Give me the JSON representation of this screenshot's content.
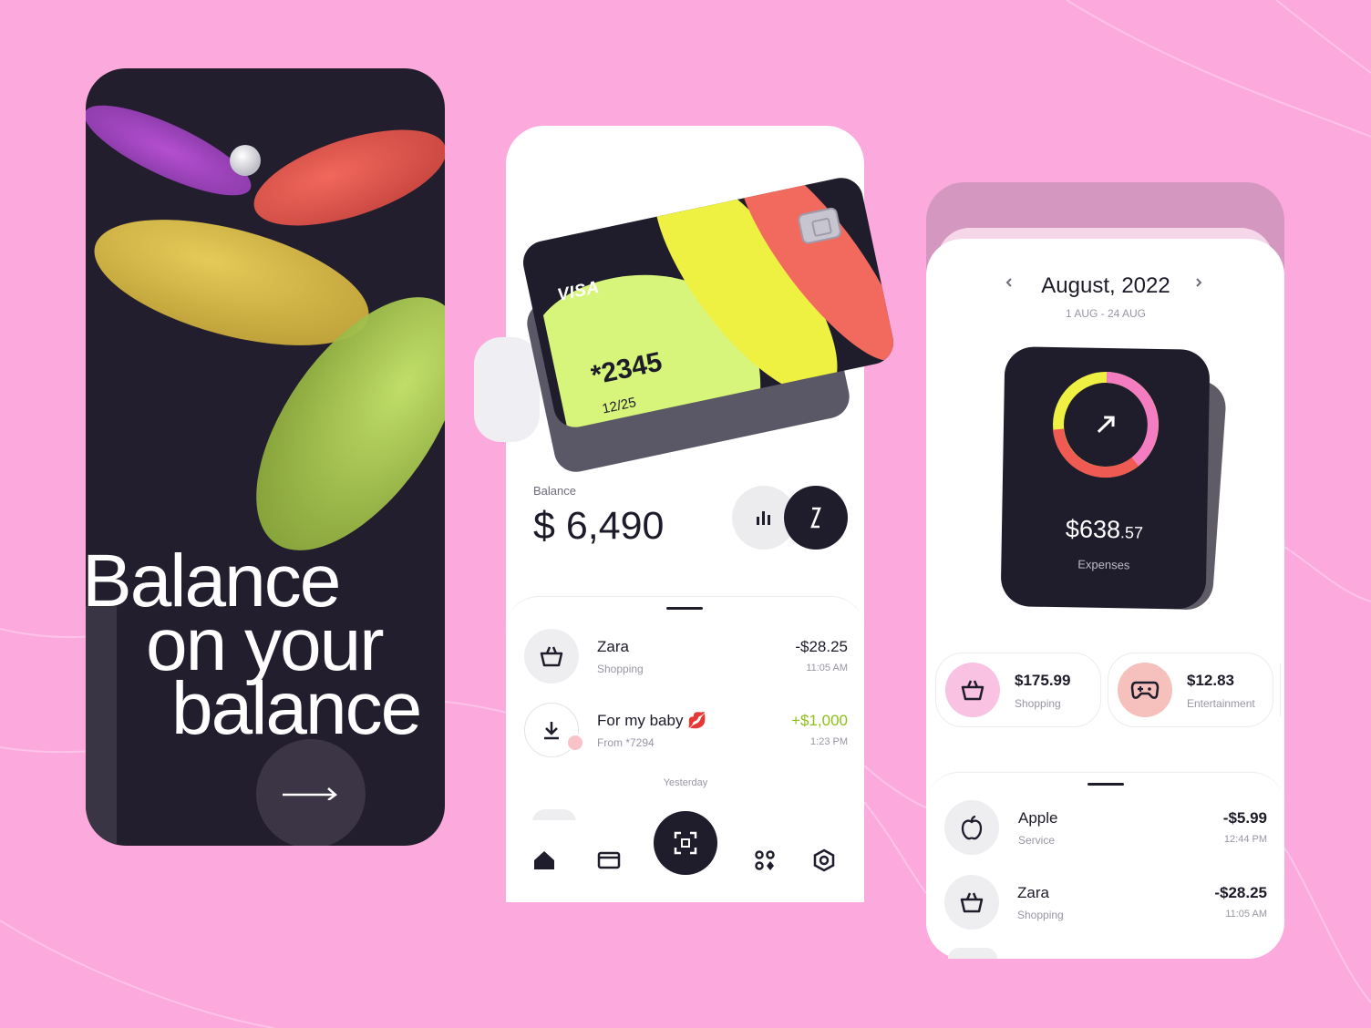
{
  "colors": {
    "background": "#fcaadd",
    "dark": "#1f1c2b",
    "accent_green": "#8cbf1a",
    "card_lime": "#d6f57a",
    "card_yellow": "#eef142",
    "card_coral": "#f26a5e",
    "ring_pink": "#f37dc0",
    "ring_red": "#ef5a52",
    "ring_yellow": "#eef142"
  },
  "onboarding": {
    "headline_line1": "Balance",
    "headline_line2": "on your",
    "headline_line3": "balance",
    "next_icon": "arrow-right-icon"
  },
  "wallet": {
    "card": {
      "brand": "VISA",
      "number": "*2345",
      "expiry": "12/25"
    },
    "balance_label": "Balance",
    "balance_value": "$ 6,490",
    "action_icons": [
      "bar-chart-icon",
      "transfer-icon"
    ],
    "transactions": [
      {
        "name": "Zara",
        "category": "Shopping",
        "amount": "-$28.25",
        "time": "11:05 AM",
        "icon": "basket-icon"
      },
      {
        "name": "For my baby 💋",
        "category": "From *7294",
        "amount": "+$1,000",
        "time": "1:23 PM",
        "icon": "download-icon"
      }
    ],
    "section_label": "Yesterday",
    "tabs": [
      "home-icon",
      "card-icon",
      "scan-icon",
      "apps-icon",
      "settings-icon"
    ]
  },
  "analytics": {
    "month": "August, 2022",
    "range": "1 AUG - 24 AUG",
    "expenses_amount": "$638",
    "expenses_cents": ".57",
    "expenses_label": "Expenses",
    "categories": [
      {
        "amount": "$175.99",
        "label": "Shopping",
        "icon": "basket-icon",
        "color": "#f9c2e3"
      },
      {
        "amount": "$12.83",
        "label": "Entertainment",
        "icon": "gamepad-icon",
        "color": "#f6c0bc"
      }
    ],
    "transactions": [
      {
        "name": "Apple",
        "category": "Service",
        "amount": "-$5.99",
        "time": "12:44 PM",
        "icon": "apple-icon"
      },
      {
        "name": "Zara",
        "category": "Shopping",
        "amount": "-$28.25",
        "time": "11:05 AM",
        "icon": "basket-icon"
      }
    ]
  }
}
